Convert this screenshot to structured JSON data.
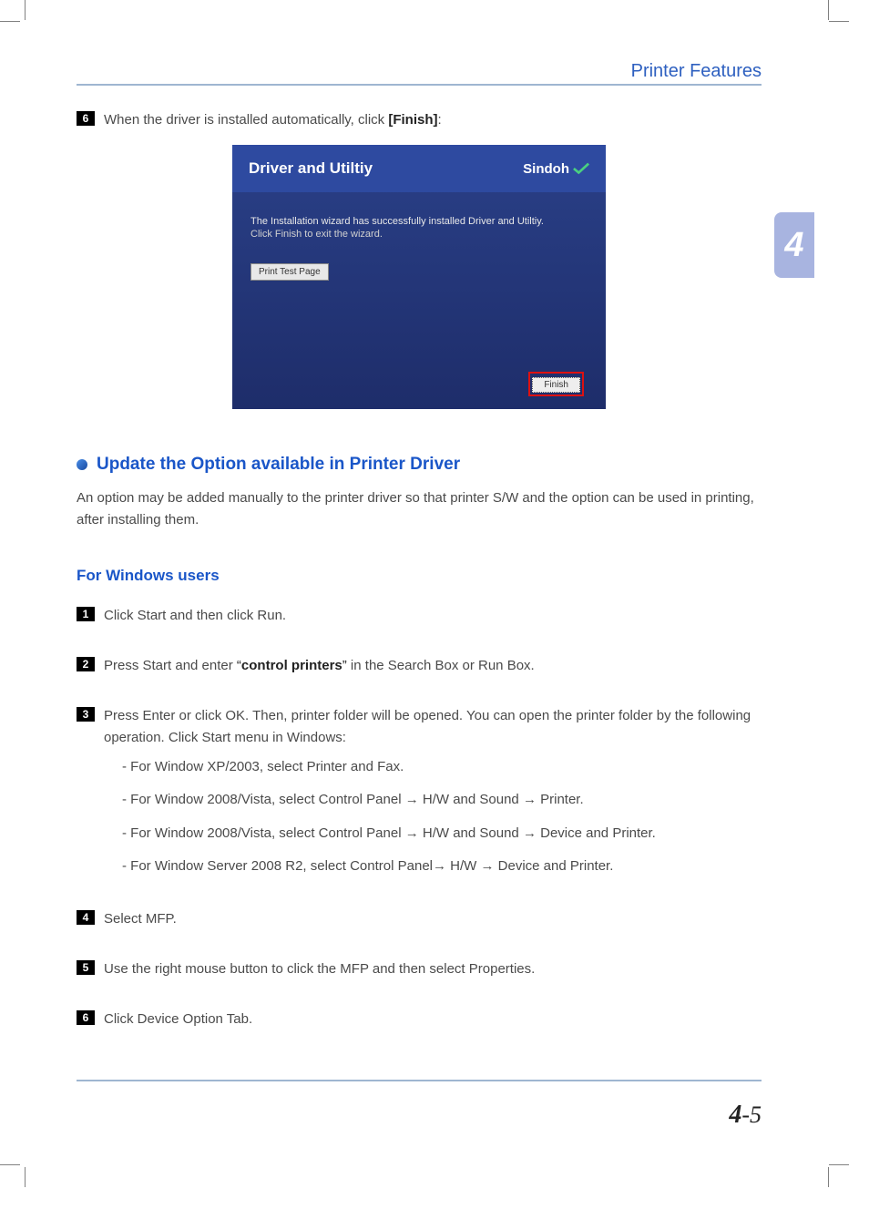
{
  "header": {
    "title": "Printer Features"
  },
  "tab": {
    "chapter": "4"
  },
  "top_step": {
    "num": "6",
    "text_a": "When the driver is installed automatically, click ",
    "text_bold": "[Finish]",
    "text_b": ":"
  },
  "installer": {
    "title": "Driver and Utiltiy",
    "brand": "Sindoh",
    "msg1": "The Installation wizard has successfully installed Driver and Utiltiy.",
    "msg2": "Click Finish to exit the wizard.",
    "print_test": "Print Test Page",
    "finish": "Finish"
  },
  "section": {
    "heading": "Update the Option available in Printer Driver",
    "para": "An option may be added manually to the printer driver so that printer S/W and the option can be used in printing, after installing them."
  },
  "subhead": "For Windows users",
  "steps": [
    {
      "num": "1",
      "text": "Click Start and then click Run."
    },
    {
      "num": "2",
      "pre": "Press Start and enter ",
      "q1": "“",
      "bold": "control printers",
      "q2": "”",
      "post": " in the Search Box or Run Box."
    },
    {
      "num": "3",
      "text": "Press Enter or click OK. Then, printer folder will be opened. You can open the printer folder by the following operation. Click Start menu in Windows:",
      "subs": [
        "For Window XP/2003, select Printer and Fax.",
        "For Window 2008/Vista, select Control Panel → H/W and Sound → Printer.",
        "For Window 2008/Vista, select Control Panel → H/W and Sound → Device and Printer.",
        "For Window Server 2008 R2, select Control Panel→ H/W → Device and Printer."
      ]
    },
    {
      "num": "4",
      "text": "Select MFP."
    },
    {
      "num": "5",
      "text": "Use the right mouse button to click the MFP and then select Properties."
    },
    {
      "num": "6",
      "text": "Click Device Option Tab."
    }
  ],
  "page_num": {
    "chapter": "4",
    "sep": "-",
    "page": "5"
  }
}
